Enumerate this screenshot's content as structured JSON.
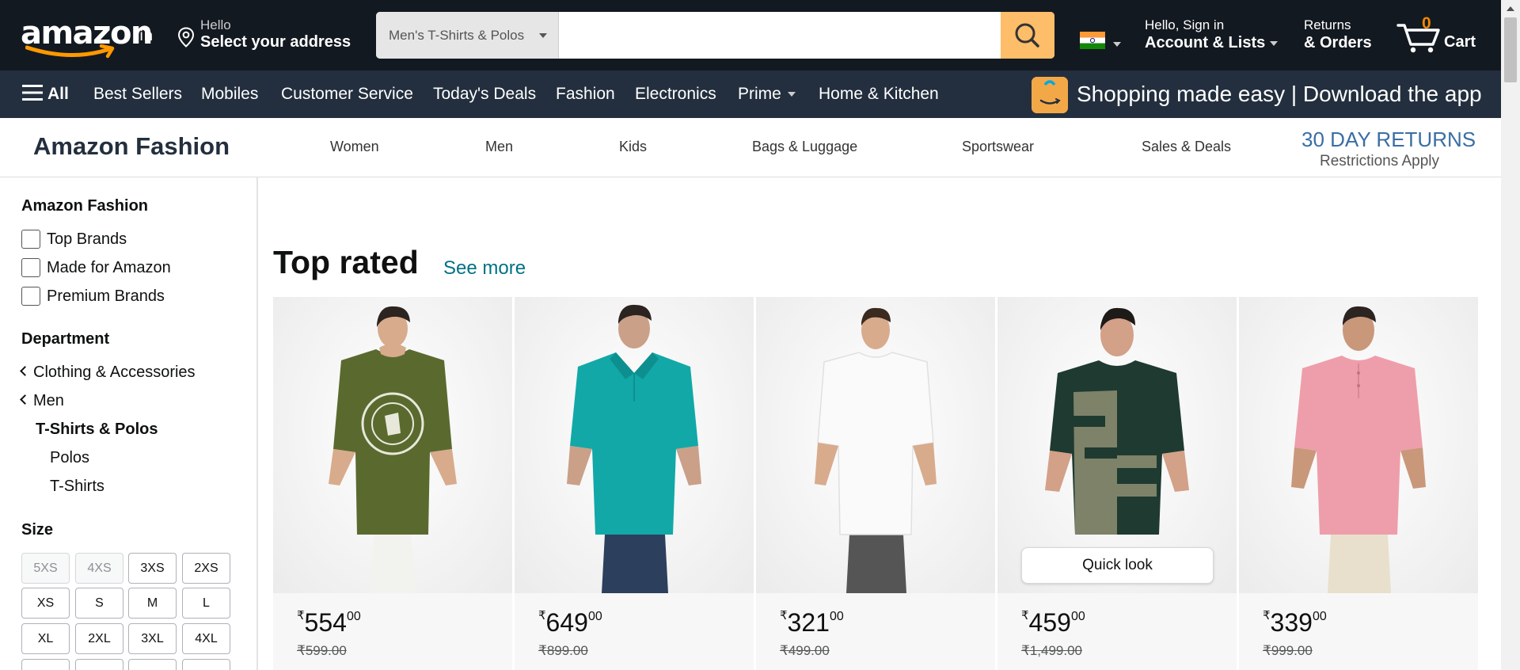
{
  "header": {
    "logo_text": "amazon",
    "logo_suffix": ".in",
    "address_hello": "Hello",
    "address_main": "Select your address",
    "search_category": "Men's T-Shirts & Polos",
    "search_placeholder": "",
    "account_line1": "Hello, Sign in",
    "account_line2": "Account & Lists",
    "orders_line1": "Returns",
    "orders_line2": "& Orders",
    "cart_count": "0",
    "cart_label": "Cart"
  },
  "subnav": {
    "all": "All",
    "items": [
      "Best Sellers",
      "Mobiles",
      "Customer Service",
      "Today's Deals",
      "Fashion",
      "Electronics",
      "Prime",
      "Home & Kitchen"
    ],
    "promo": "Shopping made easy | Download the app"
  },
  "fashion_bar": {
    "title": "Amazon Fashion",
    "links": [
      "Women",
      "Men",
      "Kids",
      "Bags & Luggage",
      "Sportswear",
      "Sales & Deals"
    ],
    "returns_line1": "30 DAY RETURNS",
    "returns_line2": "Restrictions Apply"
  },
  "sidebar": {
    "heading1": "Amazon Fashion",
    "checkboxes": [
      "Top Brands",
      "Made for Amazon",
      "Premium Brands"
    ],
    "heading2": "Department",
    "dept": [
      "Clothing & Accessories",
      "Men",
      "T-Shirts & Polos",
      "Polos",
      "T-Shirts"
    ],
    "heading3": "Size",
    "sizes": [
      "5XS",
      "4XS",
      "3XS",
      "2XS",
      "XS",
      "S",
      "M",
      "L",
      "XL",
      "2XL",
      "3XL",
      "4XL"
    ]
  },
  "main": {
    "section_title": "Top rated",
    "see_more": "See more",
    "quick_look": "Quick look",
    "products": [
      {
        "symbol": "₹",
        "whole": "554",
        "fraction": "00",
        "mrp": "₹599.00",
        "shirt_color": "#5a6a2f",
        "icon": "green-printed-tshirt-image"
      },
      {
        "symbol": "₹",
        "whole": "649",
        "fraction": "00",
        "mrp": "₹899.00",
        "shirt_color": "#12a8a8",
        "icon": "teal-polo-image"
      },
      {
        "symbol": "₹",
        "whole": "321",
        "fraction": "00",
        "mrp": "₹499.00",
        "shirt_color": "#fafafa",
        "icon": "white-tshirt-image"
      },
      {
        "symbol": "₹",
        "whole": "459",
        "fraction": "00",
        "mrp": "₹1,499.00",
        "shirt_color": "#1f3a30",
        "icon": "colorblock-tshirt-image"
      },
      {
        "symbol": "₹",
        "whole": "339",
        "fraction": "00",
        "mrp": "₹999.00",
        "shirt_color": "#ee9eaa",
        "icon": "pink-henley-tshirt-image"
      }
    ]
  },
  "colors": {
    "nav_dark": "#131921",
    "subnav": "#232f3e",
    "search_button": "#febd69",
    "cart_count": "#f08804",
    "link": "#007185",
    "returns": "#3a6ea5"
  }
}
